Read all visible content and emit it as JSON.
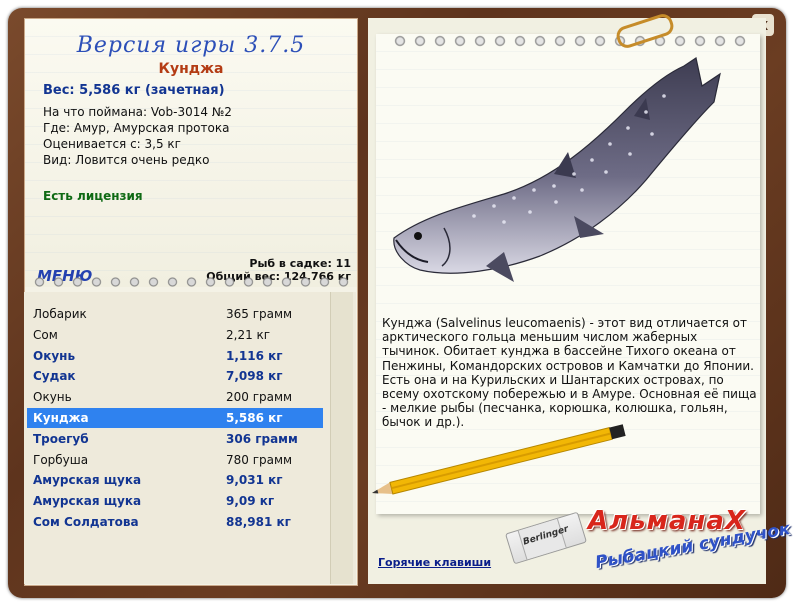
{
  "window": {
    "close_label": "x"
  },
  "header": {
    "version": "Версия игры 3.7.5"
  },
  "fish": {
    "title": "Кунджа",
    "weight": "Вес: 5,586 кг (зачетная)",
    "caught_on": "На что поймана: Vob-3014 №2",
    "location": "Где: Амур, Амурская протока",
    "value": "Оценивается с: 3,5 кг",
    "rarity": "Вид: Ловится очень редко",
    "license": "Есть лицензия",
    "description": "Кунджа (Salvelinus leucomaenis) - этот вид отличается от арктического гольца меньшим числом жаберных тычинок. Обитает кунджа в бассейне Тихого океана от Пенжины, Командорских островов и Камчатки до Японии. Есть она и на Курильских и Шантарских островах, по всему охотскому побережью и в Амуре. Основная её пища - мелкие рыбы (песчанка, корюшка, колюшка, гольян, бычок и др.)."
  },
  "keepnet": {
    "count": "Рыб в садке: 11",
    "total": "Общий вес: 124,766 кг"
  },
  "menu_label": "МЕНЮ",
  "catch_list": [
    {
      "name": "Лобарик",
      "weight": "365 грамм",
      "bold": false
    },
    {
      "name": "Сом",
      "weight": "2,21 кг",
      "bold": false
    },
    {
      "name": "Окунь",
      "weight": "1,116 кг",
      "bold": true
    },
    {
      "name": "Судак",
      "weight": "7,098 кг",
      "bold": true
    },
    {
      "name": "Окунь",
      "weight": "200 грамм",
      "bold": false
    },
    {
      "name": "Кунджа",
      "weight": "5,586 кг",
      "bold": true,
      "selected": true
    },
    {
      "name": "Троегуб",
      "weight": "306 грамм",
      "bold": true
    },
    {
      "name": "Горбуша",
      "weight": "780 грамм",
      "bold": false
    },
    {
      "name": "Амурская щука",
      "weight": "9,031 кг",
      "bold": true
    },
    {
      "name": "Амурская щука",
      "weight": "9,09 кг",
      "bold": true
    },
    {
      "name": "Сом Солдатова",
      "weight": "88,981 кг",
      "bold": true
    }
  ],
  "logo": {
    "line1": "АльманаХ",
    "line2": "Рыбацкий сундучок"
  },
  "eraser_label": "Berlinger",
  "hotkeys_label": "Горячие клавиши",
  "colors": {
    "accent": "#2f82ef",
    "cover": "#6b3d22",
    "title": "#b43c14",
    "link": "#2441b0"
  }
}
